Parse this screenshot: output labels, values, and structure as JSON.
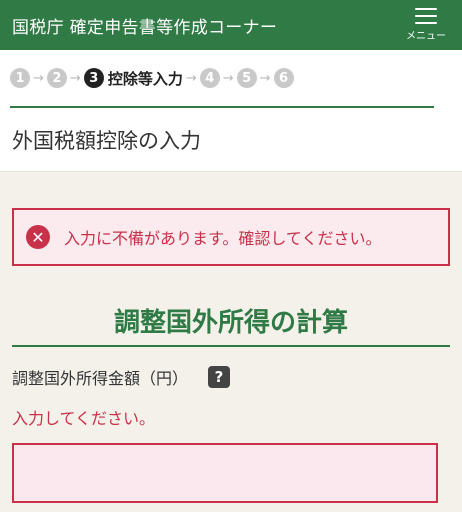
{
  "header": {
    "title": "国税庁 確定申告書等作成コーナー",
    "menu_label": "メニュー"
  },
  "steps": {
    "items": [
      "1",
      "2",
      "3",
      "4",
      "5",
      "6"
    ],
    "current_index": 3,
    "current_label": "控除等入力"
  },
  "page": {
    "title": "外国税額控除の入力"
  },
  "error_box": {
    "icon": "close-icon",
    "message": "入力に不備があります。確認してください。"
  },
  "section": {
    "title": "調整国外所得の計算"
  },
  "field": {
    "label": "調整国外所得金額（円）",
    "help_icon": "?",
    "error": "入力してください。",
    "value": ""
  },
  "colors": {
    "header_green": "#2f7a45",
    "error_red": "#c9304a",
    "error_bg": "#fbeaee"
  }
}
